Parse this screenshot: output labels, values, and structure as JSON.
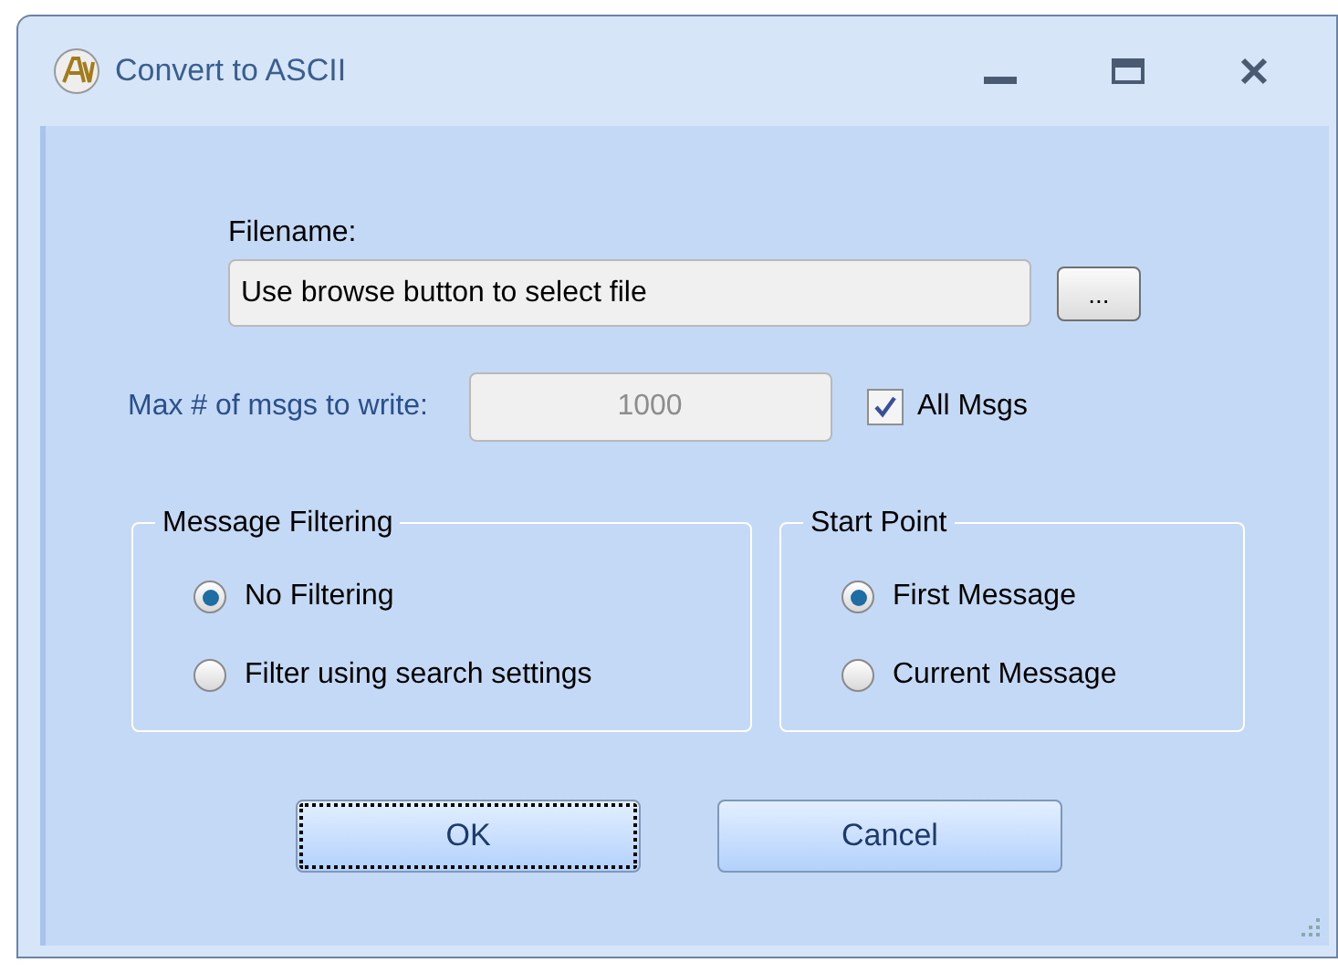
{
  "window": {
    "title": "Convert to ASCII"
  },
  "filename": {
    "label": "Filename:",
    "value": "Use browse button to select file",
    "browse_button": "..."
  },
  "max_msgs": {
    "label": "Max # of msgs to write:",
    "value": "1000",
    "disabled": true
  },
  "all_msgs": {
    "label": "All Msgs",
    "checked": true
  },
  "groups": [
    {
      "title": "Message Filtering",
      "options": [
        {
          "label": "No Filtering",
          "selected": true
        },
        {
          "label": "Filter using search settings",
          "selected": false
        }
      ]
    },
    {
      "title": "Start Point",
      "options": [
        {
          "label": "First Message",
          "selected": true
        },
        {
          "label": "Current Message",
          "selected": false
        }
      ]
    }
  ],
  "buttons": [
    {
      "label": "OK",
      "focused": true
    },
    {
      "label": "Cancel",
      "focused": false
    }
  ]
}
